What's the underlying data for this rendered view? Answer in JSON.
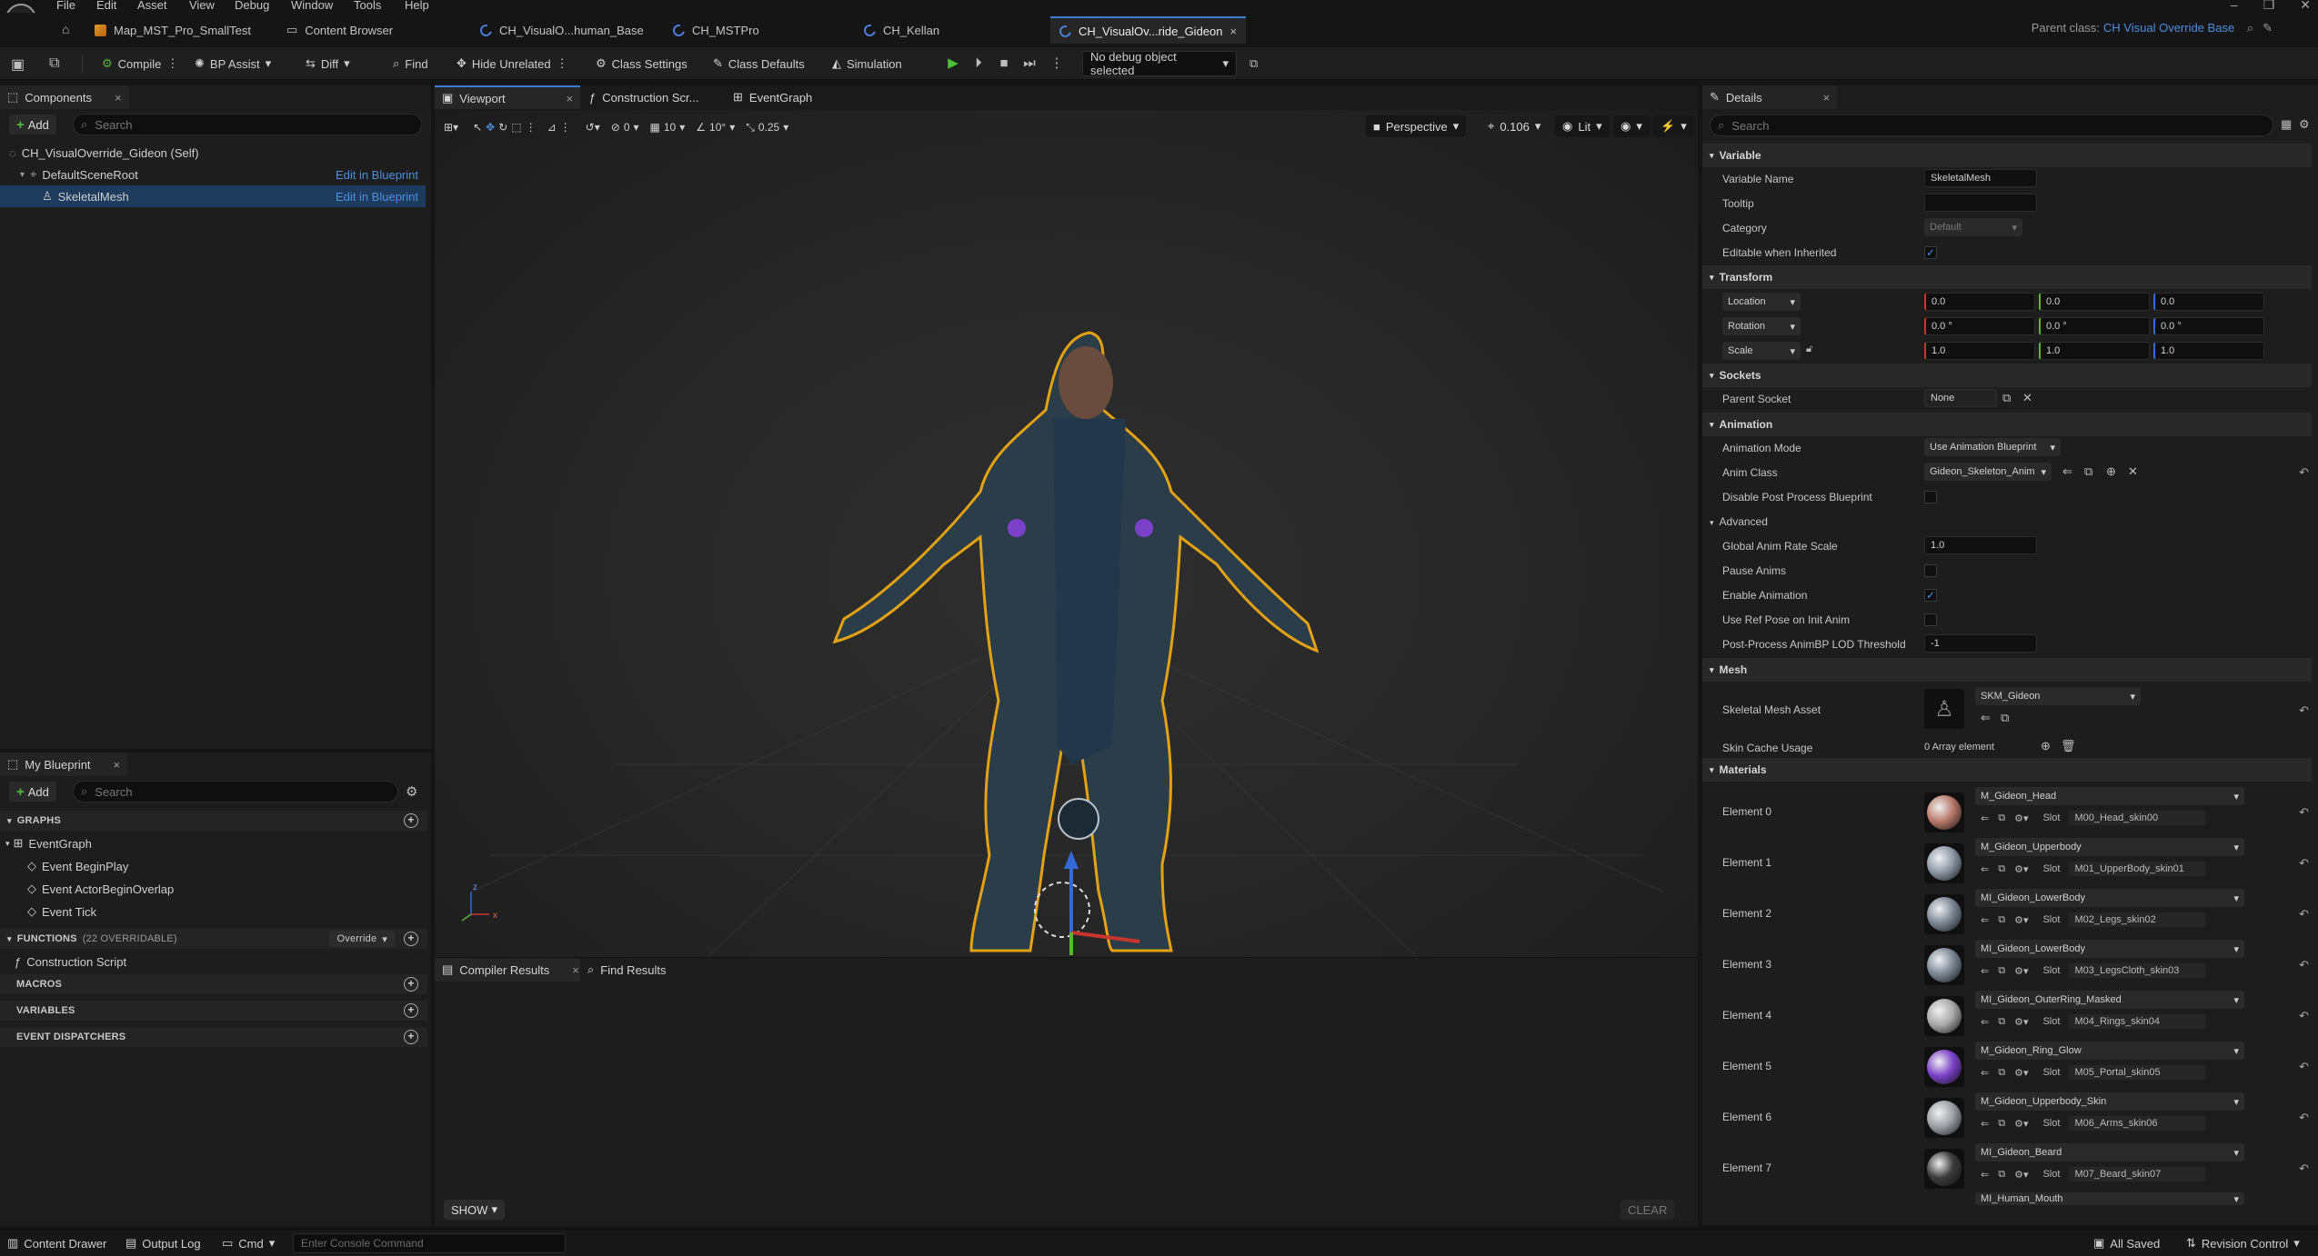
{
  "menu": [
    "File",
    "Edit",
    "Asset",
    "View",
    "Debug",
    "Window",
    "Tools",
    "Help"
  ],
  "tabs": [
    {
      "label": "Map_MST_Pro_SmallTest"
    },
    {
      "label": "Content Browser"
    },
    {
      "label": "CH_VisualO...human_Base"
    },
    {
      "label": "CH_MSTPro"
    },
    {
      "label": "CH_Kellan"
    },
    {
      "label": "CH_VisualOv...ride_Gideon"
    }
  ],
  "parent_class": {
    "label": "Parent class:",
    "value": "CH Visual Override Base"
  },
  "toolbar": {
    "compile": "Compile",
    "bp_assist": "BP Assist",
    "diff": "Diff",
    "find": "Find",
    "hide_unrelated": "Hide Unrelated",
    "class_settings": "Class Settings",
    "class_defaults": "Class Defaults",
    "simulation": "Simulation",
    "debug_select": "No debug object selected"
  },
  "components": {
    "tab": "Components",
    "add": "Add",
    "search_placeholder": "Search",
    "items": [
      {
        "label": "CH_VisualOverride_Gideon (Self)",
        "link": ""
      },
      {
        "label": "DefaultSceneRoot",
        "link": "Edit in Blueprint"
      },
      {
        "label": "SkeletalMesh",
        "link": "Edit in Blueprint"
      }
    ]
  },
  "my_blueprint": {
    "tab": "My Blueprint",
    "add": "Add",
    "search_placeholder": "Search",
    "graphs_head": "GRAPHS",
    "event_graph": "EventGraph",
    "events": [
      "Event BeginPlay",
      "Event ActorBeginOverlap",
      "Event Tick"
    ],
    "functions_head": "FUNCTIONS",
    "functions_note": "(22 OVERRIDABLE)",
    "override": "Override",
    "construction_script": "Construction Script",
    "macros_head": "MACROS",
    "variables_head": "VARIABLES",
    "dispatchers_head": "EVENT DISPATCHERS"
  },
  "editor_tabs": {
    "viewport": "Viewport",
    "construction": "Construction Scr...",
    "event_graph": "EventGraph"
  },
  "viewport_toolbar": {
    "rotate_snap": "0",
    "grid_snap": "10",
    "angle_snap": "10°",
    "scale_snap": "0.25",
    "perspective": "Perspective",
    "fov": "0.106",
    "lit": "Lit"
  },
  "bottom": {
    "compiler_results": "Compiler Results",
    "find_results": "Find Results",
    "show": "SHOW",
    "clear": "CLEAR"
  },
  "details": {
    "tab": "Details",
    "search_placeholder": "Search",
    "variable": {
      "head": "Variable",
      "variable_name_label": "Variable Name",
      "variable_name": "SkeletalMesh",
      "tooltip_label": "Tooltip",
      "category_label": "Category",
      "category": "Default",
      "editable_label": "Editable when Inherited"
    },
    "transform": {
      "head": "Transform",
      "location": "Location",
      "rotation": "Rotation",
      "scale": "Scale",
      "loc": [
        "0.0",
        "0.0",
        "0.0"
      ],
      "rot": [
        "0.0 °",
        "0.0 °",
        "0.0 °"
      ],
      "scl": [
        "1.0",
        "1.0",
        "1.0"
      ]
    },
    "sockets": {
      "head": "Sockets",
      "parent_socket_label": "Parent Socket",
      "parent_socket": "None"
    },
    "animation": {
      "head": "Animation",
      "mode_label": "Animation Mode",
      "mode": "Use Animation Blueprint",
      "anim_class_label": "Anim Class",
      "anim_class": "Gideon_Skeleton_Anim",
      "disable_pp_label": "Disable Post Process Blueprint",
      "advanced": "Advanced",
      "global_rate_label": "Global Anim Rate Scale",
      "global_rate": "1.0",
      "pause_label": "Pause Anims",
      "enable_label": "Enable Animation",
      "ref_pose_label": "Use Ref Pose on Init Anim",
      "lod_label": "Post-Process AnimBP LOD Threshold",
      "lod": "-1"
    },
    "mesh": {
      "head": "Mesh",
      "asset_label": "Skeletal Mesh Asset",
      "asset": "SKM_Gideon",
      "skin_cache_label": "Skin Cache Usage",
      "skin_cache": "0 Array element"
    },
    "materials": {
      "head": "Materials",
      "slot_label": "Slot",
      "elements": [
        {
          "label": "Element 0",
          "material": "M_Gideon_Head",
          "slot": "M00_Head_skin00",
          "color": "#b8796a"
        },
        {
          "label": "Element 1",
          "material": "M_Gideon_Upperbody",
          "slot": "M01_UpperBody_skin01",
          "color": "#8d99a6"
        },
        {
          "label": "Element 2",
          "material": "MI_Gideon_LowerBody",
          "slot": "M02_Legs_skin02",
          "color": "#7b8794"
        },
        {
          "label": "Element 3",
          "material": "MI_Gideon_LowerBody",
          "slot": "M03_LegsCloth_skin03",
          "color": "#7b8794"
        },
        {
          "label": "Element 4",
          "material": "MI_Gideon_OuterRing_Masked",
          "slot": "M04_Rings_skin04",
          "color": "#a9a9a9"
        },
        {
          "label": "Element 5",
          "material": "M_Gideon_Ring_Glow",
          "slot": "M05_Portal_skin05",
          "color": "#7b42c9"
        },
        {
          "label": "Element 6",
          "material": "M_Gideon_Upperbody_Skin",
          "slot": "M06_Arms_skin06",
          "color": "#9ca0a6"
        },
        {
          "label": "Element 7",
          "material": "MI_Gideon_Beard",
          "slot": "M07_Beard_skin07",
          "color": "#3c3c3c"
        }
      ],
      "partial": "MI_Human_Mouth"
    }
  },
  "statusbar": {
    "content_drawer": "Content Drawer",
    "output_log": "Output Log",
    "cmd": "Cmd",
    "console_placeholder": "Enter Console Command",
    "all_saved": "All Saved",
    "revision_control": "Revision Control"
  },
  "colors": {
    "accent": "#4b8fe0",
    "selection": "#1e3a5c",
    "outline": "#e3a212"
  }
}
